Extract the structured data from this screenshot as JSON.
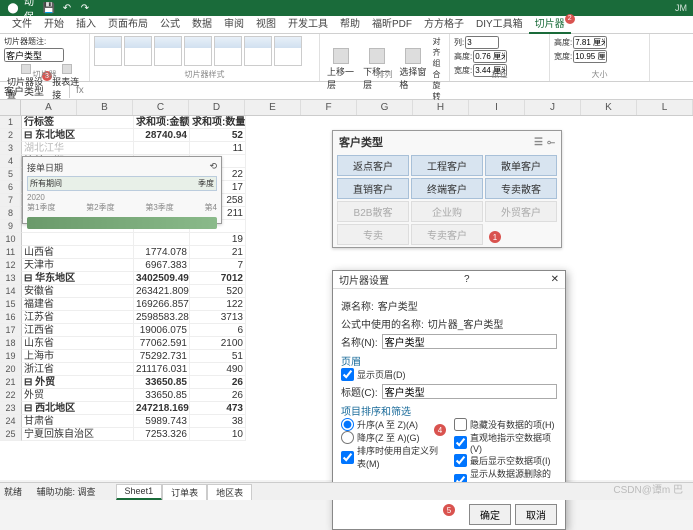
{
  "titlebar": {
    "autosave": "自动保存",
    "right_user": "JM"
  },
  "tabs": [
    "文件",
    "开始",
    "插入",
    "页面布局",
    "公式",
    "数据",
    "审阅",
    "视图",
    "开发工具",
    "帮助",
    "福昕PDF",
    "方方格子",
    "DIY工具箱",
    "切片器"
  ],
  "tabs_active": 13,
  "tab_badge": "2",
  "ribbon": {
    "g1": {
      "caption": "切片器题注:",
      "value": "客户类型",
      "btn": "切片器设置",
      "btn2": "报表连接",
      "label": "切片器",
      "badge": "3"
    },
    "g2": {
      "label": "切片器样式"
    },
    "g3": {
      "up": "上移一层",
      "down": "下移一层",
      "pane": "选择窗格",
      "align": "对齐",
      "group": "组合",
      "rotate": "旋转",
      "label": "排列"
    },
    "g4": {
      "cols": "列:",
      "cols_v": "3",
      "h": "高度:",
      "h_v": "0.76 厘米",
      "w": "宽度:",
      "w_v": "3.44 厘米",
      "label": "按钮"
    },
    "g5": {
      "h": "高度:",
      "h_v": "7.81 厘米",
      "w": "宽度:",
      "w_v": "10.95 厘米",
      "label": "大小"
    }
  },
  "namebox": "客户类型",
  "columns": [
    "A",
    "B",
    "C",
    "D",
    "E",
    "F",
    "G",
    "H",
    "I",
    "J",
    "K",
    "L"
  ],
  "pivot": {
    "header": [
      "行标签",
      "求和项:金额",
      "求和项:数量"
    ],
    "rows": [
      {
        "n": "1",
        "a": "行标签",
        "b": "求和项:金额",
        "c": "求和项:数量",
        "bold": true,
        "dd": true
      },
      {
        "n": "2",
        "a": "⊟ 东北地区",
        "b": "28740.94",
        "c": "52",
        "bold": true
      },
      {
        "n": "3",
        "a": "    湖北江华",
        "b": "",
        "c": "11",
        "dim": true
      },
      {
        "n": "4",
        "a": "接单日期",
        "b": "",
        "c": "",
        "box": true
      },
      {
        "n": "5",
        "a": "",
        "b": "",
        "c": "22"
      },
      {
        "n": "6",
        "a": "所有期间",
        "b": "",
        "c": "17"
      },
      {
        "n": "7",
        "a": "2020",
        "b": "",
        "c": "258"
      },
      {
        "n": "8",
        "a": "第1季度  第2季度  第3季度  第4",
        "b": "",
        "c": "211"
      },
      {
        "n": "9",
        "a": "",
        "b": "",
        "c": ""
      },
      {
        "n": "10",
        "a": "",
        "b": "",
        "c": "19"
      },
      {
        "n": "11",
        "a": "    山西省",
        "b": "1774.078",
        "c": "21"
      },
      {
        "n": "12",
        "a": "    天津市",
        "b": "6967.383",
        "c": "7"
      },
      {
        "n": "13",
        "a": "⊟ 华东地区",
        "b": "3402509.496",
        "c": "7012",
        "bold": true
      },
      {
        "n": "14",
        "a": "    安徽省",
        "b": "263421.809",
        "c": "520"
      },
      {
        "n": "15",
        "a": "    福建省",
        "b": "169266.8575",
        "c": "122"
      },
      {
        "n": "16",
        "a": "    江苏省",
        "b": "2598583.283",
        "c": "3713"
      },
      {
        "n": "17",
        "a": "    江西省",
        "b": "19006.075",
        "c": "6"
      },
      {
        "n": "18",
        "a": "    山东省",
        "b": "77062.591",
        "c": "2100"
      },
      {
        "n": "19",
        "a": "    上海市",
        "b": "75292.731",
        "c": "51"
      },
      {
        "n": "20",
        "a": "    浙江省",
        "b": "211176.031",
        "c": "490"
      },
      {
        "n": "21",
        "a": "⊟ 外贸",
        "b": "33650.85",
        "c": "26",
        "bold": true
      },
      {
        "n": "22",
        "a": "    外贸",
        "b": "33650.85",
        "c": "26"
      },
      {
        "n": "23",
        "a": "⊟ 西北地区",
        "b": "247218.169",
        "c": "473",
        "bold": true
      },
      {
        "n": "24",
        "a": "    甘肃省",
        "b": "5989.743",
        "c": "38"
      },
      {
        "n": "25",
        "a": "    宁夏回族自治区",
        "b": "7253.326",
        "c": "10"
      }
    ]
  },
  "slicer_date": {
    "title": "接单日期",
    "all": "所有期间",
    "unit": "季度",
    "year": "2020",
    "q": [
      "第1季度",
      "第2季度",
      "第3季度",
      "第4"
    ]
  },
  "slicer": {
    "title": "客户类型",
    "items": [
      {
        "t": "返点客户"
      },
      {
        "t": "工程客户"
      },
      {
        "t": "散单客户"
      },
      {
        "t": "直销客户"
      },
      {
        "t": "终端客户"
      },
      {
        "t": "专卖散客"
      },
      {
        "t": "B2B散客",
        "dim": true
      },
      {
        "t": "企业购",
        "dim": true
      },
      {
        "t": "外贸客户",
        "dim": true
      },
      {
        "t": "专卖",
        "dim": true
      },
      {
        "t": "专卖客户",
        "dim": true
      }
    ],
    "badge": "1"
  },
  "dialog": {
    "title": "切片器设置",
    "src_label": "源名称:",
    "src": "客户类型",
    "formula_label": "公式中使用的名称:",
    "formula": "切片器_客户类型",
    "name_label": "名称(N):",
    "name": "客户类型",
    "header_section": "页眉",
    "show_header": "显示页眉(D)",
    "caption_label": "标题(C):",
    "caption": "客户类型",
    "sort_section": "项目排序和筛选",
    "sort_asc": "升序(A 至 Z)(A)",
    "sort_desc": "降序(Z 至 A)(G)",
    "custom_sort": "排序时使用自定义列表(M)",
    "hide_empty": "隐藏没有数据的项(H)",
    "visual_empty": "直观地指示空数据项(V)",
    "show_empty_last": "最后显示空数据项(I)",
    "show_deleted": "显示从数据源删除的项目(O)",
    "badge4": "4",
    "badge5": "5",
    "ok": "确定",
    "cancel": "取消"
  },
  "sheets": [
    "Sheet1",
    "订单表",
    "地区表"
  ],
  "sheets_active": 0,
  "status": {
    "ready": "就绪",
    "acc": "辅助功能: 调查"
  },
  "watermark": "CSDN@谭m 巴"
}
